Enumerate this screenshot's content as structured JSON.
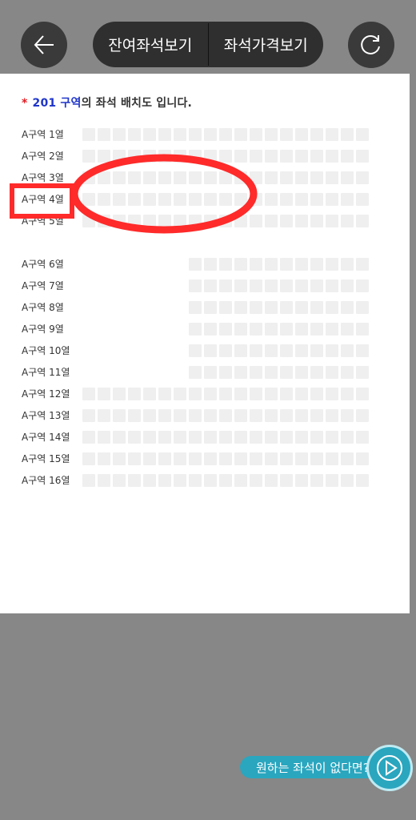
{
  "header": {
    "tabs": [
      {
        "label": "잔여좌석보기"
      },
      {
        "label": "좌석가격보기"
      }
    ]
  },
  "seatmap": {
    "heading": {
      "star": "*",
      "section": "201 구역",
      "suffix": "의 좌석 배치도 입니다."
    },
    "rows": [
      {
        "label": "A구역 1열",
        "seats": 19,
        "start": 0
      },
      {
        "label": "A구역 2열",
        "seats": 19,
        "start": 0
      },
      {
        "label": "A구역 3열",
        "seats": 19,
        "start": 0
      },
      {
        "label": "A구역 4열",
        "seats": 19,
        "start": 0
      },
      {
        "label": "A구역 5열",
        "seats": 19,
        "start": 0
      },
      {
        "label": "A구역 6열",
        "seats": 12,
        "start": 7
      },
      {
        "label": "A구역 7열",
        "seats": 12,
        "start": 7
      },
      {
        "label": "A구역 8열",
        "seats": 12,
        "start": 7
      },
      {
        "label": "A구역 9열",
        "seats": 12,
        "start": 7
      },
      {
        "label": "A구역 10열",
        "seats": 12,
        "start": 7
      },
      {
        "label": "A구역 11열",
        "seats": 12,
        "start": 7
      },
      {
        "label": "A구역 12열",
        "seats": 19,
        "start": 0
      },
      {
        "label": "A구역 13열",
        "seats": 19,
        "start": 0
      },
      {
        "label": "A구역 14열",
        "seats": 19,
        "start": 0
      },
      {
        "label": "A구역 15열",
        "seats": 19,
        "start": 0
      },
      {
        "label": "A구역 16열",
        "seats": 19,
        "start": 0
      }
    ]
  },
  "promo": {
    "label": "원하는 좌석이 없다면?"
  },
  "colors": {
    "annotation": "#ff2a2a",
    "accent": "#2aa6bf",
    "section": "#1f35c9"
  }
}
